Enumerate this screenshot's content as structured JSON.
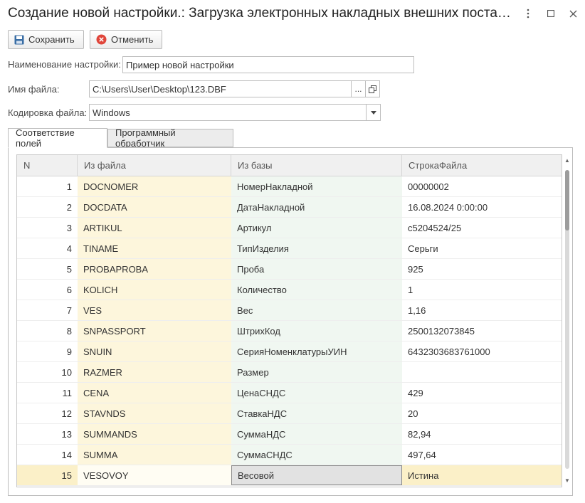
{
  "window": {
    "title": "Создание новой настройки.: Загрузка электронных накладных внешних поста…"
  },
  "toolbar": {
    "save_label": "Сохранить",
    "cancel_label": "Отменить"
  },
  "form": {
    "name_label": "Наименование настройки:",
    "name_value": "Пример новой настройки",
    "file_label": "Имя файла:",
    "file_value": "C:\\Users\\User\\Desktop\\123.DBF",
    "file_dots": "...",
    "encoding_label": "Кодировка файла:",
    "encoding_value": "Windows"
  },
  "tabs": [
    {
      "label": "Соответствие полей"
    },
    {
      "label": "Программный обработчик"
    }
  ],
  "grid": {
    "columns": [
      "N",
      "Из файла",
      "Из базы",
      "СтрокаФайла"
    ],
    "rows": [
      {
        "n": "1",
        "from_file": "DOCNOMER",
        "from_db": "НомерНакладной",
        "file_value": "00000002"
      },
      {
        "n": "2",
        "from_file": "DOCDATA",
        "from_db": "ДатаНакладной",
        "file_value": "16.08.2024 0:00:00"
      },
      {
        "n": "3",
        "from_file": "ARTIKUL",
        "from_db": "Артикул",
        "file_value": "c5204524/25"
      },
      {
        "n": "4",
        "from_file": "TINAME",
        "from_db": "ТипИзделия",
        "file_value": "Серьги"
      },
      {
        "n": "5",
        "from_file": "PROBAPROBA",
        "from_db": "Проба",
        "file_value": "925"
      },
      {
        "n": "6",
        "from_file": "KOLICH",
        "from_db": "Количество",
        "file_value": "1"
      },
      {
        "n": "7",
        "from_file": "VES",
        "from_db": "Вес",
        "file_value": "1,16"
      },
      {
        "n": "8",
        "from_file": "SNPASSPORT",
        "from_db": "ШтрихКод",
        "file_value": "2500132073845"
      },
      {
        "n": "9",
        "from_file": "SNUIN",
        "from_db": "СерияНоменклатурыУИН",
        "file_value": "6432303683761000"
      },
      {
        "n": "10",
        "from_file": "RAZMER",
        "from_db": "Размер",
        "file_value": ""
      },
      {
        "n": "11",
        "from_file": "CENA",
        "from_db": "ЦенаСНДС",
        "file_value": "429"
      },
      {
        "n": "12",
        "from_file": "STAVNDS",
        "from_db": "СтавкаНДС",
        "file_value": "20"
      },
      {
        "n": "13",
        "from_file": "SUMMANDS",
        "from_db": "СуммаНДС",
        "file_value": "82,94"
      },
      {
        "n": "14",
        "from_file": "SUMMA",
        "from_db": "СуммаСНДС",
        "file_value": "497,64"
      },
      {
        "n": "15",
        "from_file": "VESOVOY",
        "from_db": "Весовой",
        "file_value": "Истина"
      }
    ],
    "selected_row": 15
  },
  "colors": {
    "file_column": "#fdf6dc",
    "db_column": "#f0f7f1",
    "selected_row": "#fbf0c8",
    "cancel_icon": "#e0453a",
    "save_icon": "#3a6ea5"
  },
  "icons": {
    "save": "floppy-disk-icon",
    "cancel": "cancel-circle-icon",
    "open": "open-window-icon",
    "dropdown": "chevron-down-icon",
    "menu": "more-vertical-icon",
    "maximize": "maximize-icon",
    "close": "close-icon"
  }
}
